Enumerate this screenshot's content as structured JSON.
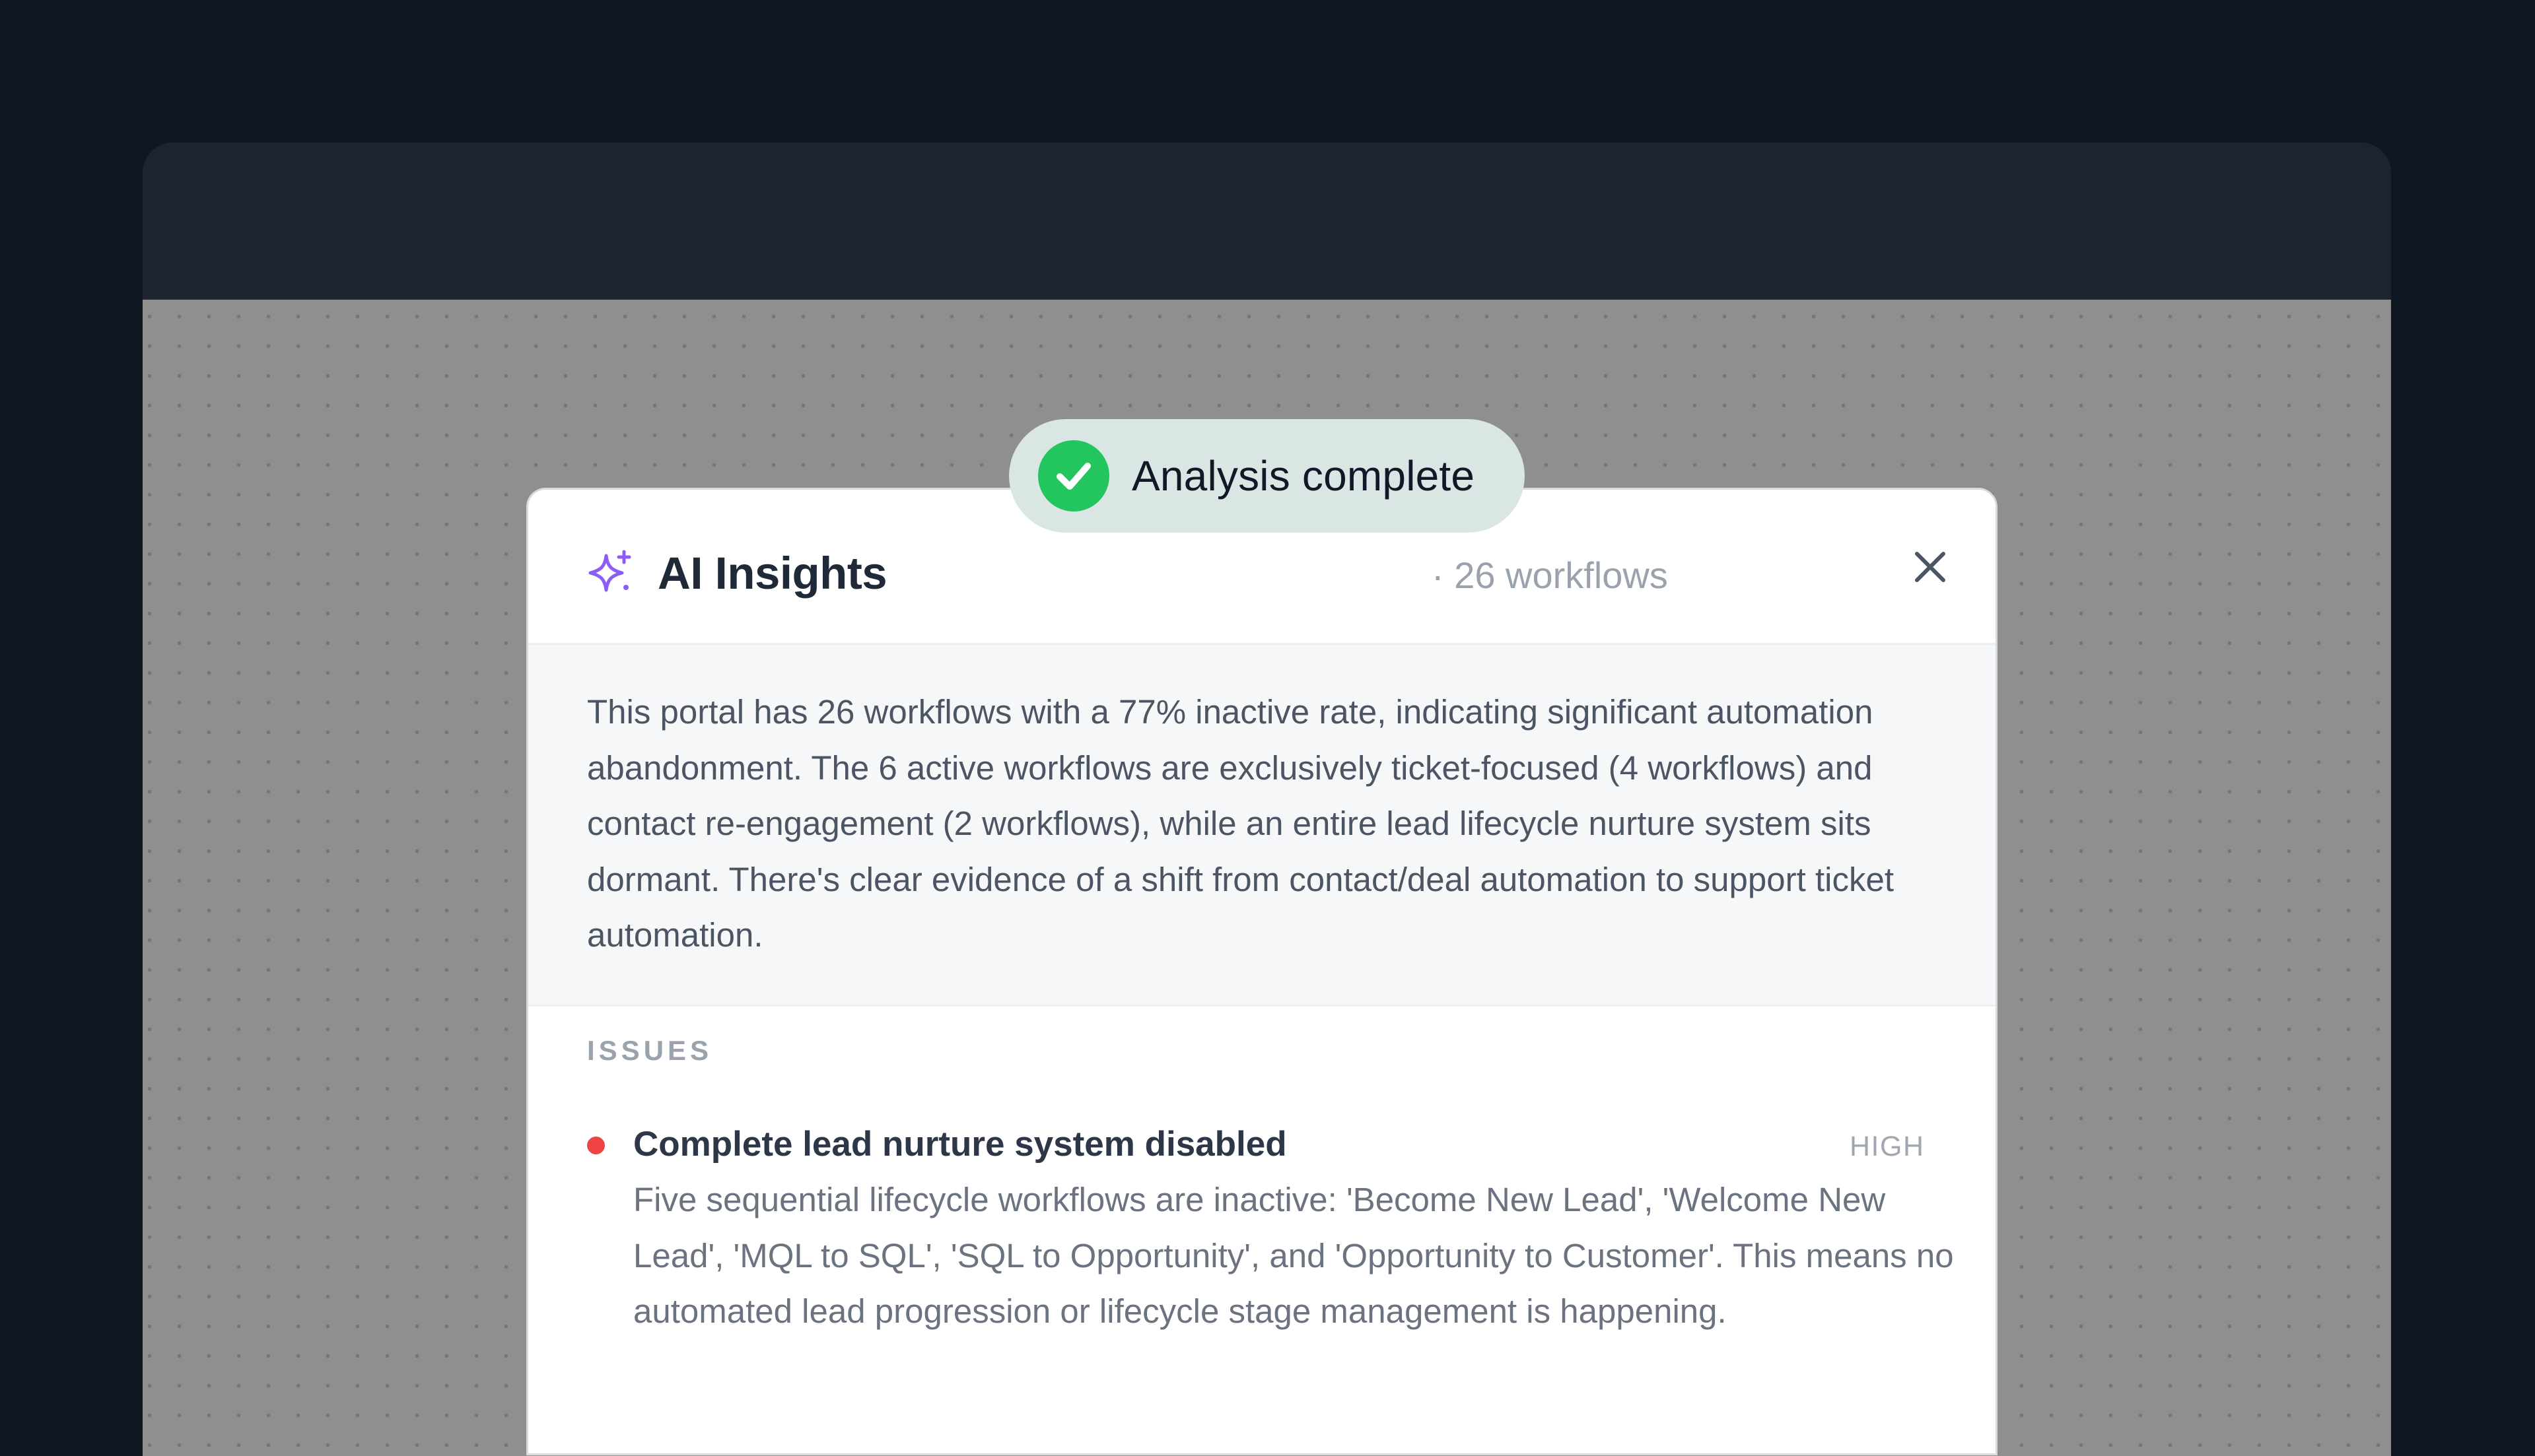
{
  "toast": {
    "icon": "check-circle-icon",
    "text": "Analysis complete"
  },
  "modal": {
    "icon": "sparkle-icon",
    "title": "AI Insights",
    "subtitle": "· 26 workflows",
    "close_icon": "close-icon",
    "summary": "This portal has 26 workflows with a 77% inactive rate, indicating significant automation abandonment. The 6 active workflows are exclusively ticket-focused (4 workflows) and contact re-engagement (2 workflows), while an entire lead lifecycle nurture system sits dormant. There's clear evidence of a shift from contact/deal automation to support ticket automation.",
    "issues_label": "ISSUES",
    "issues": [
      {
        "title": "Complete lead nurture system disabled",
        "severity": "HIGH",
        "severity_color": "#ef4444",
        "description": "Five sequential lifecycle workflows are inactive: 'Become New Lead', 'Welcome New Lead', 'MQL to SQL', 'SQL to Opportunity', and 'Opportunity to Customer'. This means no automated lead progression or lifecycle stage management is happening."
      }
    ]
  },
  "colors": {
    "background": "#0f1822",
    "window": "#1b2430",
    "overlay": "#8f8f8f",
    "accent_purple": "#8b5cf6",
    "success_green": "#22c55e",
    "toast_bg": "#d9e6e3"
  }
}
